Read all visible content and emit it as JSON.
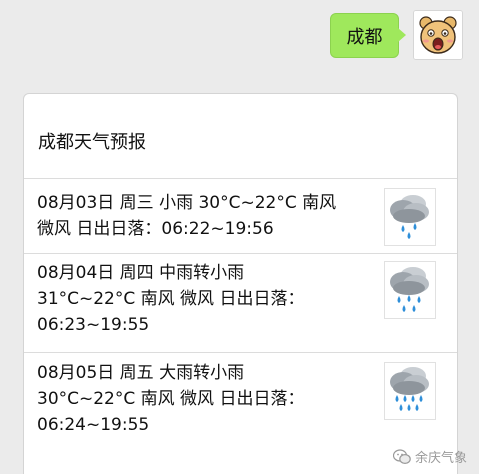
{
  "sent_message": {
    "text": "成都"
  },
  "card": {
    "title": "成都天气预报",
    "forecasts": [
      {
        "line1": "08月03日 周三 小雨 30°C~22°C 南风",
        "line2": "微风 日出日落：06:22~19:56",
        "icon": "light-rain-cloud-icon"
      },
      {
        "line1": "08月04日 周四 中雨转小雨",
        "line2": "31°C~22°C 南风 微风 日出日落：",
        "line3": "06:23~19:55",
        "icon": "moderate-rain-cloud-icon"
      },
      {
        "line1": "08月05日 周五 大雨转小雨",
        "line2": "30°C~22°C 南风 微风 日出日落：",
        "line3": "06:24~19:55",
        "icon": "heavy-rain-cloud-icon"
      }
    ]
  },
  "watermark": {
    "text": "余庆气象",
    "icon": "wechat-icon"
  },
  "colors": {
    "chat_background": "#ebebeb",
    "sent_bubble": "#9fe85c",
    "card_background": "#ffffff",
    "rain_drop": "#2f8fd9"
  }
}
